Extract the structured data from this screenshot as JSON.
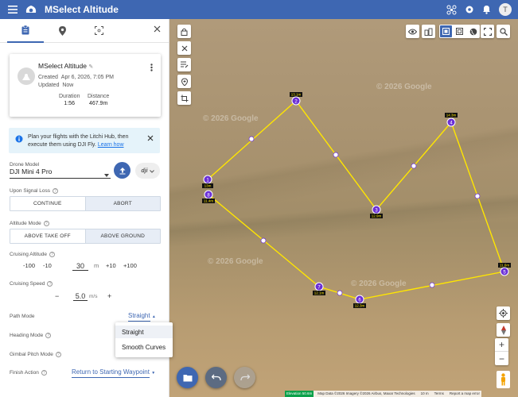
{
  "app": {
    "title": "MSelect Altitude",
    "user_initial": "T"
  },
  "mission": {
    "name": "MSelect Altitude",
    "created_label": "Created",
    "created_value": "Apr 6, 2026, 7:05 PM",
    "updated_label": "Updated",
    "updated_value": "Now",
    "duration_label": "Duration",
    "duration_value": "1:56",
    "distance_label": "Distance",
    "distance_value": "467.9m"
  },
  "info": {
    "text": "Plan your flights with the Litchi Hub, then execute them using DJI Fly.",
    "link": "Learn how"
  },
  "drone": {
    "label": "Drone Model",
    "value": "DJI Mini 4 Pro"
  },
  "signal": {
    "label": "Upon Signal Loss",
    "options": [
      "CONTINUE",
      "ABORT"
    ],
    "selected": "ABORT"
  },
  "altitude_mode": {
    "label": "Altitude Mode",
    "options": [
      "ABOVE TAKE OFF",
      "ABOVE GROUND"
    ],
    "selected": "ABOVE GROUND"
  },
  "cruising_altitude": {
    "label": "Cruising Altitude",
    "minus100": "-100",
    "minus10": "-10",
    "value": "30",
    "unit": "m",
    "plus10": "+10",
    "plus100": "+100"
  },
  "cruising_speed": {
    "label": "Cruising Speed",
    "minus": "−",
    "value": "5.0",
    "unit": "m/s",
    "plus": "+"
  },
  "path_mode": {
    "label": "Path Mode",
    "value": "Straight",
    "options": [
      "Straight",
      "Smooth Curves"
    ]
  },
  "heading_mode": {
    "label": "Heading Mode"
  },
  "gimbal_mode": {
    "label": "Gimbal Pitch Mode"
  },
  "finish_action": {
    "label": "Finish Action",
    "value": "Return to Starting Waypoint"
  },
  "map": {
    "watermark": "© 2026 Google",
    "waypoints": [
      {
        "n": "1",
        "alt": "13m"
      },
      {
        "n": "2",
        "alt": "13.1m"
      },
      {
        "n": "3",
        "alt": "12.9m"
      },
      {
        "n": "4",
        "alt": "14.3m"
      },
      {
        "n": "5",
        "alt": "11.6m"
      },
      {
        "n": "6",
        "alt": "12.3m"
      },
      {
        "n": "7",
        "alt": "12.1m"
      },
      {
        "n": "8",
        "alt": "11.4m"
      }
    ],
    "footer": {
      "elevation": "Elevation 50.6m",
      "mapdata": "Map Data ©2026 Imagery ©2026 Airbus, Maxar Technologies",
      "scale": "10 m",
      "terms": "Terms",
      "report": "Report a map error"
    }
  },
  "colors": {
    "primary": "#3e67b2",
    "path": "#ffe600",
    "waypoint": "#6a2fd6"
  }
}
